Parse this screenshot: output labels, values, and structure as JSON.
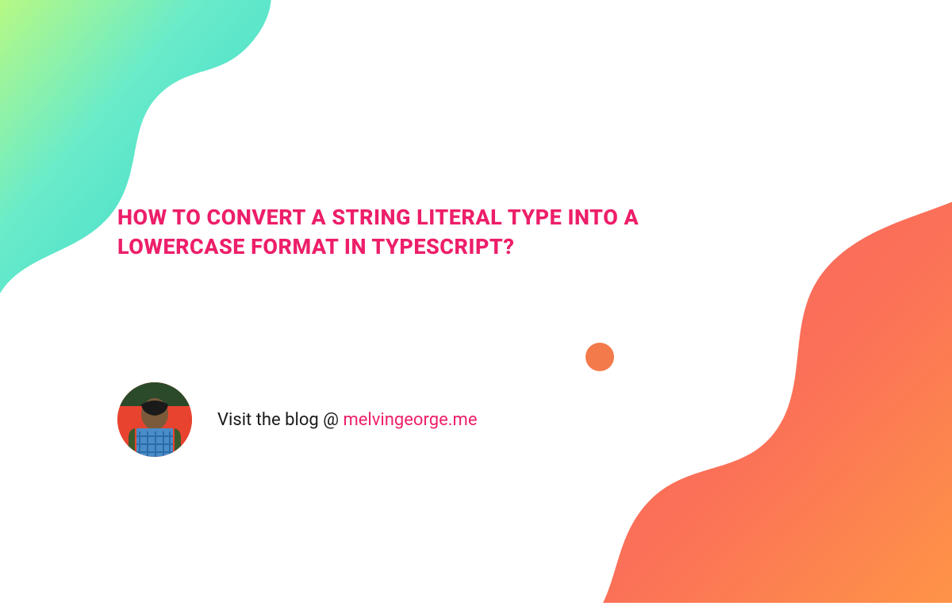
{
  "title": "HOW TO CONVERT A STRING LITERAL TYPE INTO A LOWERCASE FORMAT IN TYPESCRIPT?",
  "byline_prefix": "Visit the blog @ ",
  "byline_link": "melvingeorge.me",
  "colors": {
    "accent": "#ed1e6a",
    "dot": "#f37a4a"
  }
}
